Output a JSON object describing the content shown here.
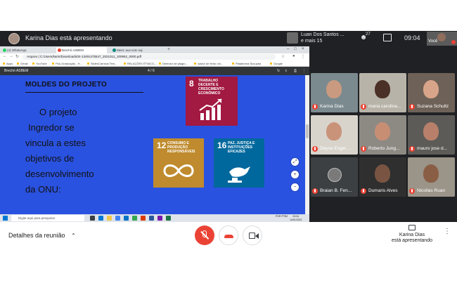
{
  "meet": {
    "presenter_title": "Karina Dias está apresentando",
    "others_line1": "Luan Dos Santos ...",
    "others_line2": "e mais 15",
    "participant_count": "27",
    "clock": "09:04",
    "self_label": "Você"
  },
  "browser": {
    "tabs": [
      {
        "label": "(4) WhatsApp",
        "color": "#25d366"
      },
      {
        "label": "Brechó ASBEM",
        "color": "#ea4335"
      },
      {
        "label": "Meet: aux-xvtc-xaj",
        "color": "#00897b"
      }
    ],
    "new_tab": "+",
    "url": "Arquivo  |  C:/Users/karin/Downloads/SI-13491475547_2021012_100952_0000.pdf",
    "bookmarks": [
      "Apps",
      "Gmail",
      "YouTube",
      "Pós-Graduação - H...",
      "SlidesCarnival Tem...",
      "RELAÇÕES ÉTNICO-...",
      "Detector de plágio...",
      "castor de texto onl...",
      "Plataforma Sucupira",
      "Google"
    ]
  },
  "pdf": {
    "name": "Brechó ASBEM",
    "page_indicator": "4 / 6",
    "download": "⭳",
    "print": "⎙",
    "more": "⋮"
  },
  "slide": {
    "heading": "MOLDES DO PROJETO",
    "paragraph_lines": [
      "O projeto",
      "Ingredor  se",
      "vincula a estes",
      "objetivos de",
      "desenvolvimento",
      "da ONU:"
    ],
    "ods": [
      {
        "number": "8",
        "title": "TRABALHO DECENTE E CRESCIMENTO ECONÔMICO",
        "color": "#a21942"
      },
      {
        "number": "12",
        "title": "CONSUMO E PRODUÇÃO RESPONSÁVEIS",
        "color": "#bf8b2e"
      },
      {
        "number": "16",
        "title": "PAZ, JUSTIÇA E INSTITUIÇÕES EFICAZES",
        "color": "#00689d"
      }
    ],
    "zoom_in": "+",
    "zoom_out": "−",
    "fit": "⤢"
  },
  "taskbar": {
    "search_placeholder": "Digite aqui para pesquisar",
    "status": "POR PTB2",
    "time": "09:04",
    "date": "14/01/2021"
  },
  "participants": [
    {
      "name": "Karina Dias",
      "wall": "#7b8a8f",
      "skin": "#c99a7f"
    },
    {
      "name": "maria carolina...",
      "wall": "#b8b3a8",
      "skin": "#4a3026"
    },
    {
      "name": "Suzana Schultz",
      "wall": "#6e6258",
      "skin": "#d9a58a"
    },
    {
      "name": "Deyse Engel ...",
      "wall": "#d8d4cc",
      "skin": "#c9937a"
    },
    {
      "name": "Roberto Jung...",
      "wall": "#8d8a84",
      "skin": "#c78e74"
    },
    {
      "name": "mauro jose d...",
      "wall": "#5c5b58",
      "skin": "#b8806a"
    },
    {
      "name": "Braian B. Fen...",
      "wall": "#3c4043",
      "skin": "#3c4043",
      "avatar": true
    },
    {
      "name": "Dumaris Alves",
      "wall": "#2f2f2f",
      "skin": "#7a5443"
    },
    {
      "name": "Nicollas Ruan",
      "wall": "#9b9488",
      "skin": "#8a5e45"
    }
  ],
  "controls": {
    "details_label": "Detalhes da reunião",
    "presenting_text": "Karina Dias\nestá apresentando"
  },
  "colors": {
    "meet_dark": "#202124",
    "slide_blue": "#2a52e0",
    "mic_red": "#ea4335"
  }
}
